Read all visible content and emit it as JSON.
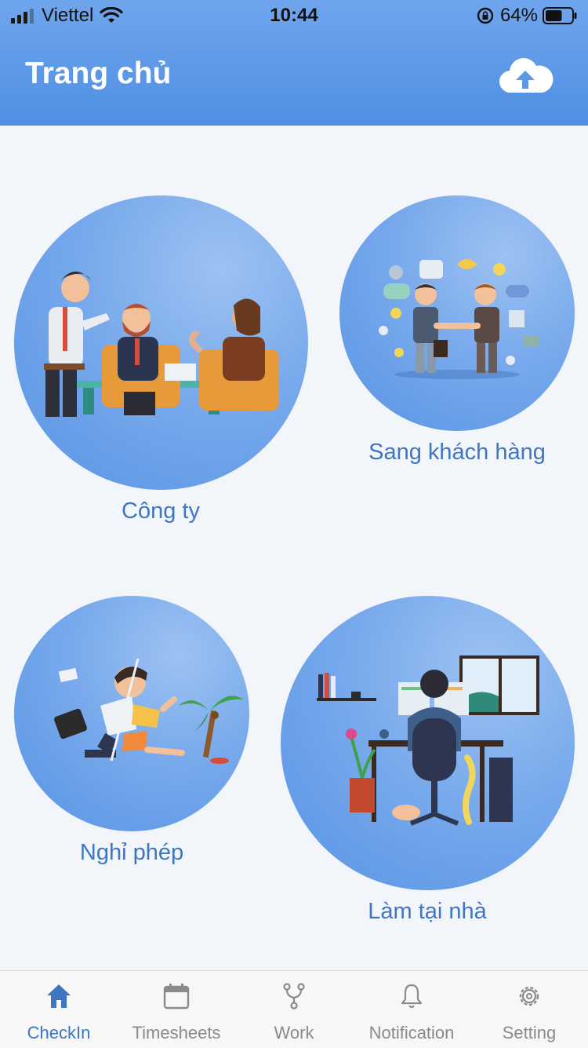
{
  "status_bar": {
    "carrier": "Viettel",
    "time": "10:44",
    "battery": "64%",
    "battery_level": 0.64
  },
  "header": {
    "title": "Trang chủ",
    "upload_icon": "cloud-upload-icon"
  },
  "options": [
    {
      "label": "Công ty",
      "illustration": "meeting-illustration"
    },
    {
      "label": "Sang khách hàng",
      "illustration": "handshake-illustration"
    },
    {
      "label": "Nghỉ phép",
      "illustration": "vacation-illustration"
    },
    {
      "label": "Làm tại nhà",
      "illustration": "work-from-home-illustration"
    }
  ],
  "tabs": [
    {
      "label": "CheckIn",
      "icon": "home-icon",
      "active": true
    },
    {
      "label": "Timesheets",
      "icon": "calendar-icon",
      "active": false
    },
    {
      "label": "Work",
      "icon": "git-branch-icon",
      "active": false
    },
    {
      "label": "Notification",
      "icon": "bell-icon",
      "active": false
    },
    {
      "label": "Setting",
      "icon": "gear-icon",
      "active": false
    }
  ],
  "colors": {
    "header": "#5a97e6",
    "accent": "#3f76c4",
    "inactive": "#8a8a8a",
    "background": "#f2f5fa"
  }
}
